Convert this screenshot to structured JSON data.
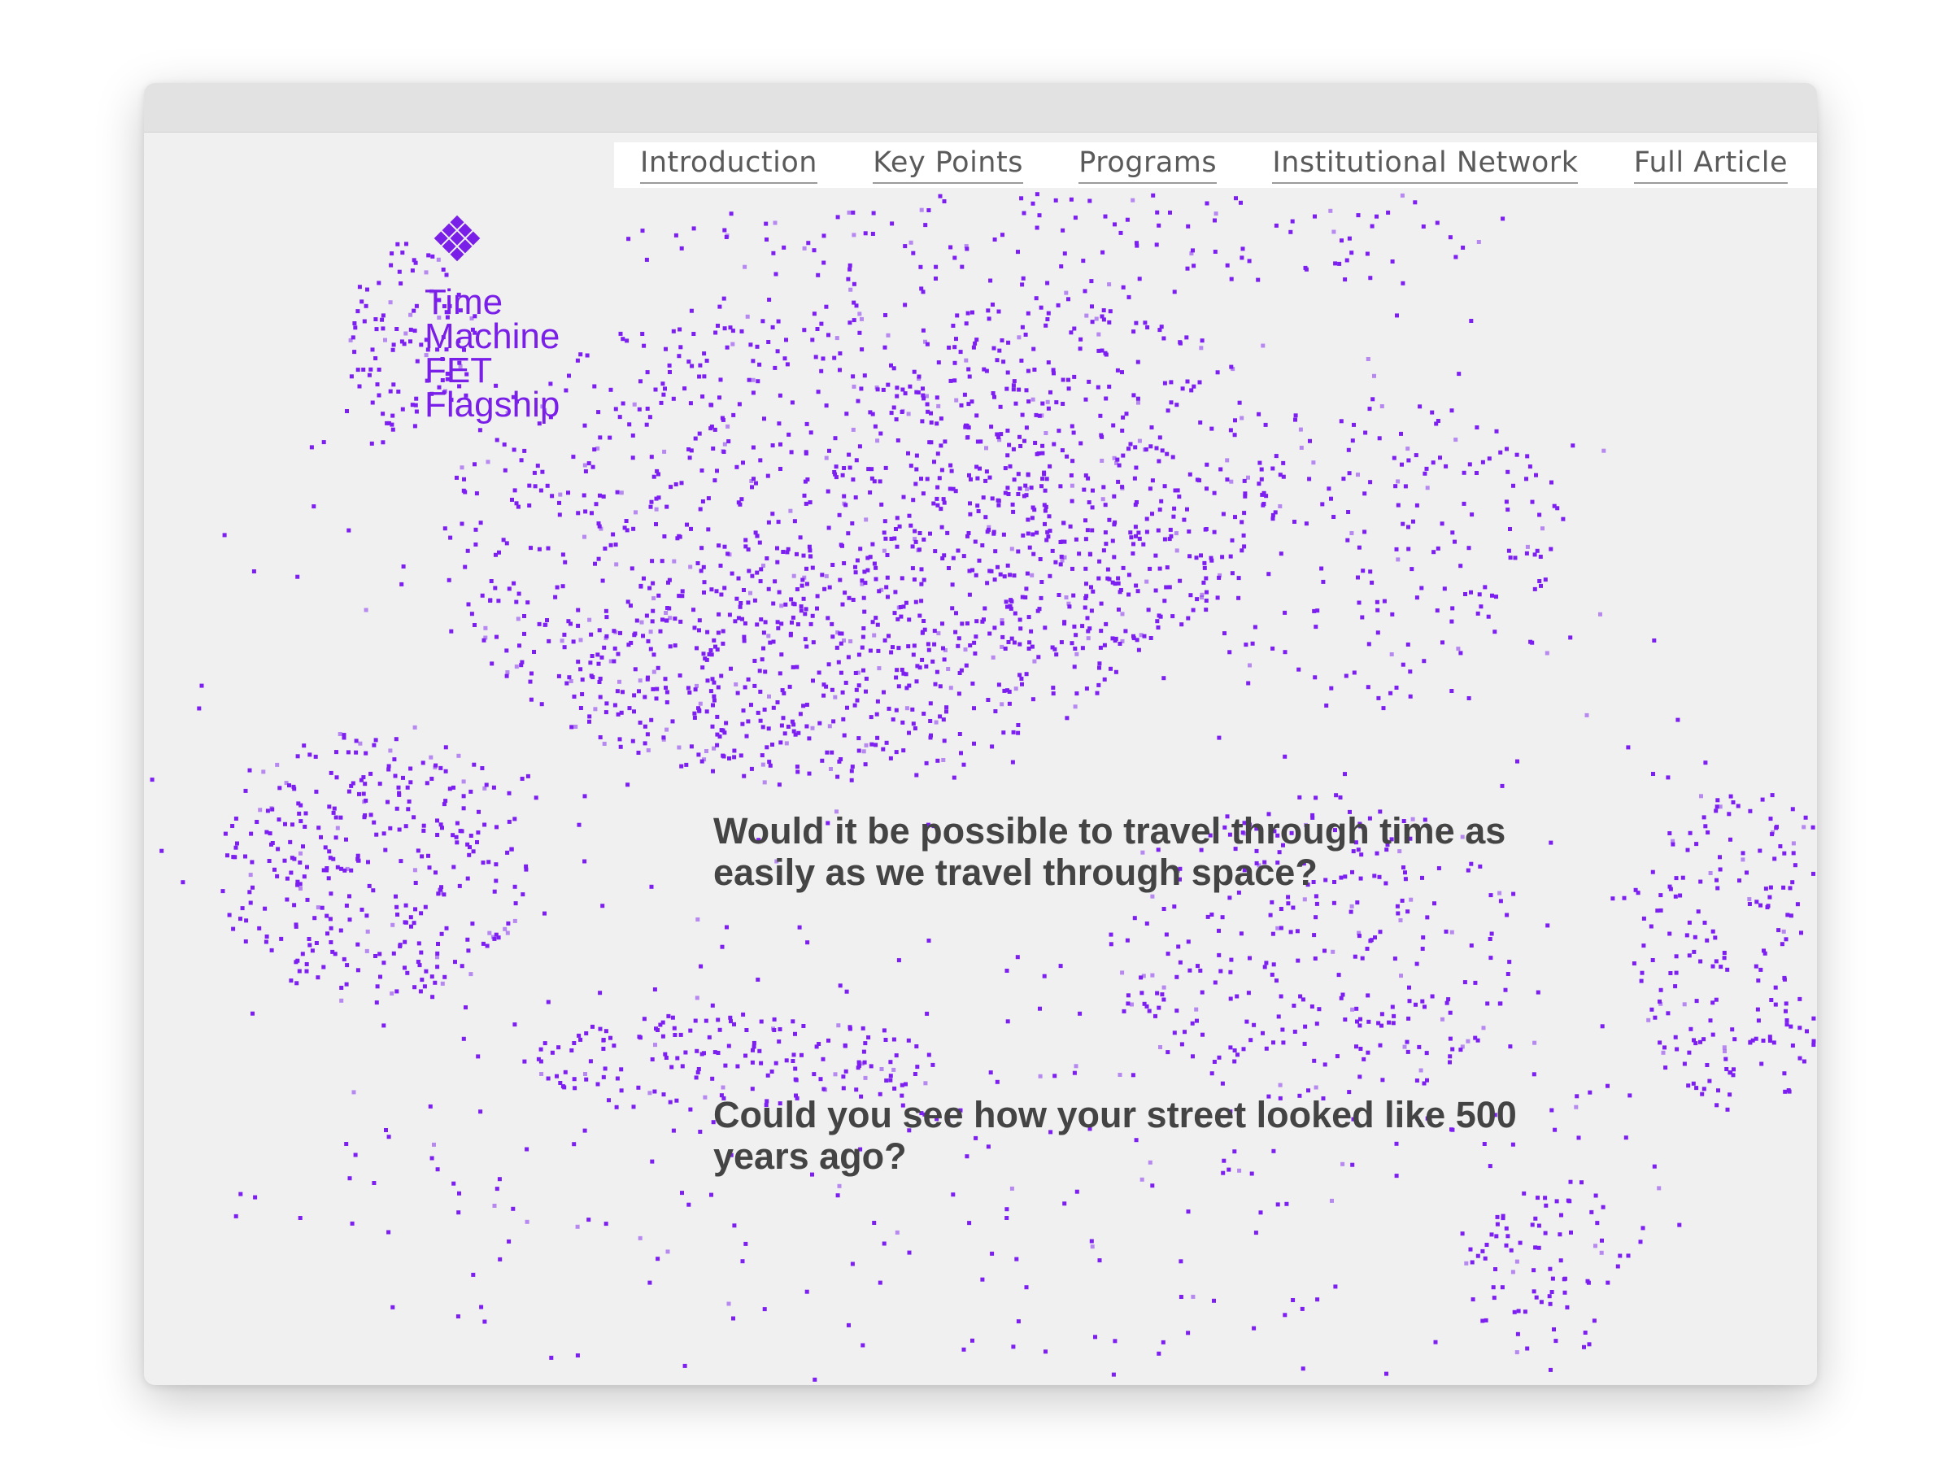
{
  "nav": {
    "items": [
      {
        "label": "Introduction"
      },
      {
        "label": "Key Points"
      },
      {
        "label": "Programs"
      },
      {
        "label": "Institutional Network"
      },
      {
        "label": "Full Article"
      }
    ]
  },
  "brand": {
    "lines": [
      "Time",
      "Machine",
      "FET",
      "Flagship"
    ],
    "icon": "diamond-grid-logo-icon"
  },
  "questions": [
    {
      "text": "Would it be possible to travel through time as easily as we travel through space?"
    },
    {
      "text": "Could you see how your street looked like 500 years ago?"
    }
  ],
  "colors": {
    "accent": "#7a1fe8",
    "dot": "#7c1ff0",
    "text": "#444444",
    "nav_text": "#5a5a5a",
    "background": "#f0f0f0"
  }
}
